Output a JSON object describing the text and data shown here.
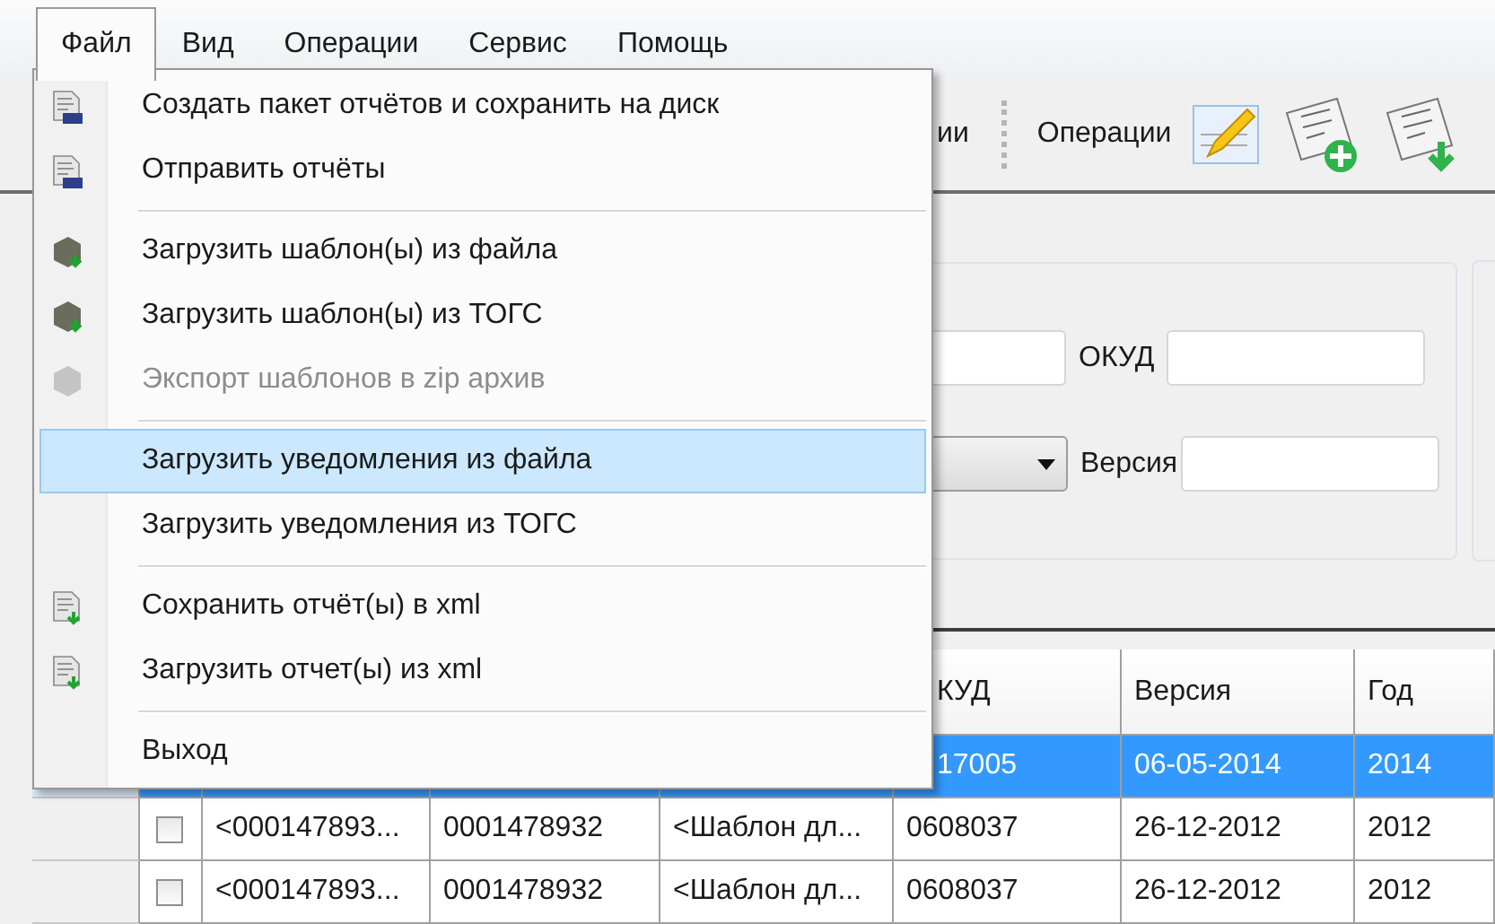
{
  "menubar": [
    {
      "label": "Файл",
      "selected": true
    },
    {
      "label": "Вид",
      "selected": false
    },
    {
      "label": "Операции",
      "selected": false
    },
    {
      "label": "Сервис",
      "selected": false
    },
    {
      "label": "Помощь",
      "selected": false
    }
  ],
  "file_menu": [
    {
      "kind": "report",
      "label": "Создать пакет отчётов и сохранить на диск",
      "disabled": false,
      "selected": false
    },
    {
      "kind": "report",
      "label": "Отправить отчёты",
      "disabled": false,
      "selected": false
    },
    {
      "kind": "separator"
    },
    {
      "kind": "template",
      "label": "Загрузить шаблон(ы) из файла",
      "disabled": false,
      "selected": false
    },
    {
      "kind": "template",
      "label": "Загрузить шаблон(ы) из ТОГС",
      "disabled": false,
      "selected": false
    },
    {
      "kind": "template",
      "label": "Экспорт шаблонов в zip архив",
      "disabled": true,
      "selected": false
    },
    {
      "kind": "separator"
    },
    {
      "kind": "plain",
      "label": "Загрузить уведомления из файла",
      "disabled": false,
      "selected": true
    },
    {
      "kind": "plain",
      "label": "Загрузить уведомления из ТОГС",
      "disabled": false,
      "selected": false
    },
    {
      "kind": "separator"
    },
    {
      "kind": "xml",
      "label": "Сохранить отчёт(ы) в xml",
      "disabled": false,
      "selected": false
    },
    {
      "kind": "xml",
      "label": "Загрузить отчет(ы) из xml",
      "disabled": false,
      "selected": false
    },
    {
      "kind": "separator"
    },
    {
      "kind": "plain",
      "label": "Выход",
      "disabled": false,
      "selected": false
    }
  ],
  "toolbar": {
    "cut_label": "ии",
    "group_label": "Операции"
  },
  "filter": {
    "okud_label": "ОКУД",
    "version_label": "Версия"
  },
  "table": {
    "header_cells": [
      "",
      "",
      "",
      "КУД",
      "Версия",
      "Год"
    ],
    "rows": [
      {
        "selected": true,
        "cells": [
          "",
          "",
          "",
          "17005",
          "06-05-2014",
          "2014"
        ]
      },
      {
        "selected": false,
        "checked": false,
        "cells": [
          "<000147893...",
          "0001478932",
          "<Шаблон дл...",
          "0608037",
          "26-12-2012",
          "2012"
        ]
      },
      {
        "selected": false,
        "checked": false,
        "cells": [
          "<000147893...",
          "0001478932",
          "<Шаблон дл...",
          "0608037",
          "26-12-2012",
          "2012"
        ]
      }
    ]
  }
}
